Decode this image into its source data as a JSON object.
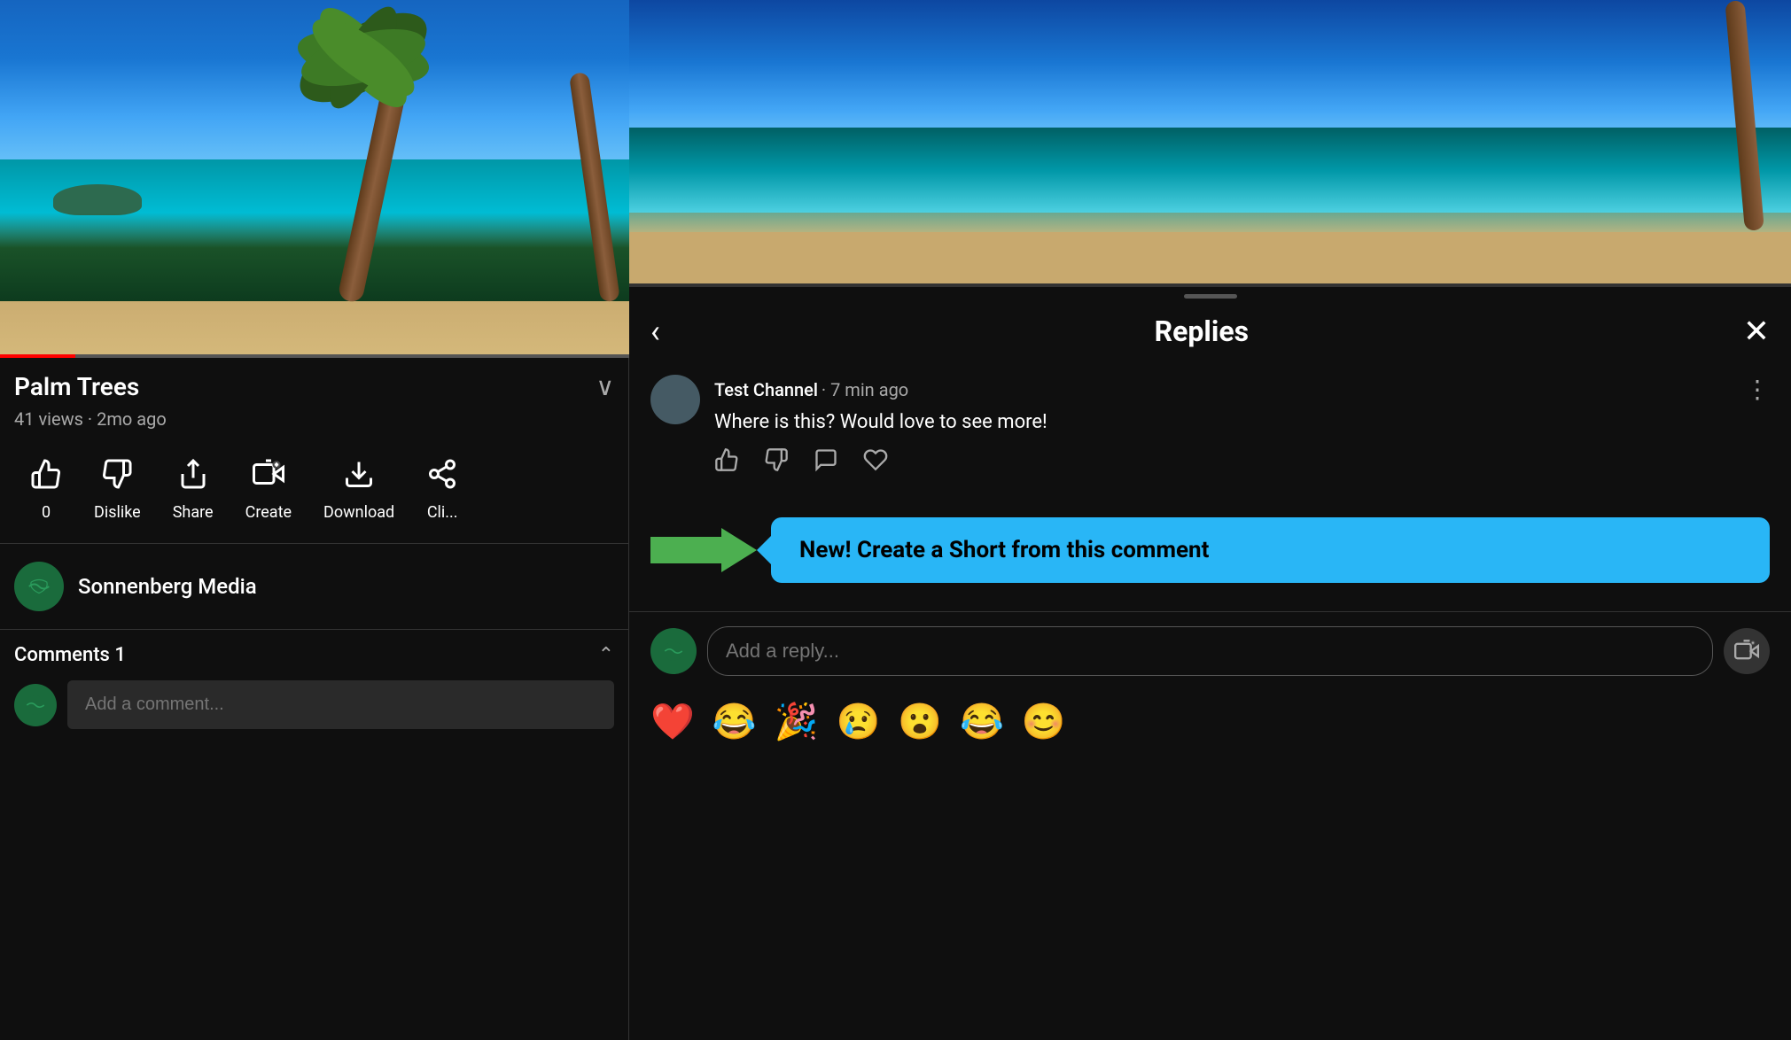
{
  "left": {
    "video": {
      "title": "Palm Trees",
      "views": "41 views",
      "age": "2mo ago"
    },
    "actions": [
      {
        "id": "like",
        "icon": "👍",
        "label": "0"
      },
      {
        "id": "dislike",
        "icon": "👎",
        "label": "Dislike"
      },
      {
        "id": "share",
        "icon": "↗",
        "label": "Share"
      },
      {
        "id": "create",
        "icon": "✂",
        "label": "Create"
      },
      {
        "id": "download",
        "icon": "⬇",
        "label": "Download"
      },
      {
        "id": "clip",
        "icon": "✂",
        "label": "Cli..."
      }
    ],
    "channel": {
      "name": "Sonnenberg Media"
    },
    "comments": {
      "title": "Comments",
      "count": "1",
      "placeholder": "Add a comment..."
    }
  },
  "right": {
    "replies": {
      "title": "Replies",
      "back_label": "‹",
      "close_label": "✕"
    },
    "comment": {
      "author": "Test Channel",
      "time": "7 min ago",
      "text": "Where is this? Would love to see more!"
    },
    "feature": {
      "text": "New! Create a Short from this comment"
    },
    "reply_input": {
      "placeholder": "Add a reply..."
    },
    "emojis": [
      "❤️",
      "😂",
      "🎉",
      "😢",
      "😮",
      "😂",
      "😊"
    ]
  }
}
